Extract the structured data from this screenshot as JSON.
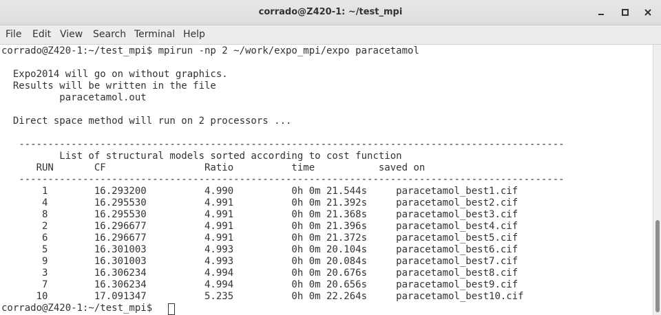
{
  "window": {
    "title": "corrado@Z420-1: ~/test_mpi",
    "icons": [
      "minimize-icon",
      "maximize-icon",
      "close-icon"
    ]
  },
  "menu": {
    "items": [
      "File",
      "Edit",
      "View",
      "Search",
      "Terminal",
      "Help"
    ]
  },
  "terminal": {
    "lines": [
      "corrado@Z420-1:~/test_mpi$ mpirun -np 2 ~/work/expo_mpi/expo paracetamol",
      "",
      "  Expo2014 will go on without graphics.",
      "  Results will be written in the file",
      "          paracetamol.out",
      "",
      "  Direct space method will run on 2 processors ...",
      "",
      "   ----------------------------------------------------------------------------------------------",
      "          List of structural models sorted according to cost function",
      "      RUN       CF                 Ratio          time           saved on",
      "   ----------------------------------------------------------------------------------------------",
      "       1        16.293200          4.990          0h 0m 21.544s     paracetamol_best1.cif",
      "       4        16.295530          4.991          0h 0m 21.392s     paracetamol_best2.cif",
      "       8        16.295530          4.991          0h 0m 21.368s     paracetamol_best3.cif",
      "       2        16.296677          4.991          0h 0m 21.396s     paracetamol_best4.cif",
      "       6        16.296677          4.991          0h 0m 21.372s     paracetamol_best5.cif",
      "       5        16.301003          4.993          0h 0m 20.104s     paracetamol_best6.cif",
      "       9        16.301003          4.993          0h 0m 20.084s     paracetamol_best7.cif",
      "       3        16.306234          4.994          0h 0m 20.676s     paracetamol_best8.cif",
      "       7        16.306234          4.994          0h 0m 20.656s     paracetamol_best9.cif",
      "      10        17.091347          5.235          0h 0m 22.264s     paracetamol_best10.cif",
      "corrado@Z420-1:~/test_mpi$ "
    ]
  },
  "colors": {
    "titlebar": "#e0e0df",
    "menubar": "#ededeb",
    "terminal_bg": "#ffffff",
    "terminal_fg": "#2e3436",
    "scroll_thumb": "#8b8e8f"
  }
}
